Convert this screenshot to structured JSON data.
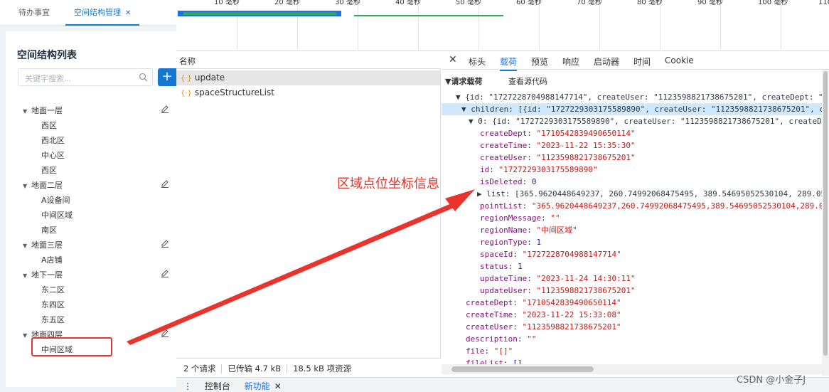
{
  "app": {
    "tabs": [
      {
        "label": "待办事宜"
      },
      {
        "label": "空间结构管理"
      }
    ],
    "panel_title": "空间结构列表",
    "search_placeholder": "关键字搜索...",
    "add_label": "+",
    "floors": [
      {
        "label": "地面一层",
        "rooms": [
          "西区",
          "西北区",
          "中心区",
          "西区"
        ]
      },
      {
        "label": "地面二层",
        "rooms": [
          "A设备间",
          "中间区域",
          "南区"
        ]
      },
      {
        "label": "地面三层",
        "rooms": [
          "A店铺"
        ]
      },
      {
        "label": "地下一层",
        "rooms": [
          "东二区",
          "东四区",
          "东五区"
        ]
      },
      {
        "label": "地面四层",
        "rooms": [
          "中间区域"
        ]
      }
    ]
  },
  "timeline": {
    "ticks": [
      "10 毫秒",
      "20 毫秒",
      "30 毫秒",
      "40 毫秒",
      "50 毫秒",
      "60 毫秒",
      "70 毫秒",
      "80 毫秒",
      "90 毫秒",
      "100 毫秒",
      "110 毫"
    ]
  },
  "network": {
    "column_header": "名称",
    "requests": [
      {
        "name": "update"
      },
      {
        "name": "spaceStructureList"
      }
    ],
    "status": {
      "requests": "2 个请求",
      "transferred": "已传输 4.7 kB",
      "resources": "18.5 kB 项资源"
    }
  },
  "detail": {
    "tabs": [
      "标头",
      "载荷",
      "预览",
      "响应",
      "启动器",
      "时间",
      "Cookie"
    ],
    "section_title": "▼请求载荷",
    "view_source": "查看源代码",
    "lines": [
      {
        "text": "▼ {id: \"1727228704988147714\", createUser: \"1123598821738675201\", createDept: \""
      },
      {
        "text": "▼ children: [{id: \"1727229303175589890\", createUser: \"1123598821738675201\", c"
      },
      {
        "text": "▼ 0: {id: \"1727229303175589890\", createUser: \"1123598821738675201\", createD"
      },
      {
        "key": "createDept",
        "val": "\"1710542839490650114\""
      },
      {
        "key": "createTime",
        "val": "\"2023-11-22 15:35:30\""
      },
      {
        "key": "createUser",
        "val": "\"1123598821738675201\""
      },
      {
        "key": "id",
        "val": "\"1727229303175589890\""
      },
      {
        "key": "isDeleted",
        "val": "0"
      },
      {
        "text": "▶ list: [365.9620448649237, 260.74992068475495, 389.54695052530104, 289.05"
      },
      {
        "key": "pointList",
        "val": "\"365.9620448649237,260.74992068475495,389.54695052530104,289.0"
      },
      {
        "key": "regionMessage",
        "val": "\"\""
      },
      {
        "key": "regionName",
        "val": "\"中间区域\""
      },
      {
        "key": "regionType",
        "val": "1"
      },
      {
        "key": "spaceId",
        "val": "\"1727228704988147714\""
      },
      {
        "key": "status",
        "val": "1"
      },
      {
        "key": "updateTime",
        "val": "\"2023-11-24 14:30:11\""
      },
      {
        "key": "updateUser",
        "val": "\"1123598821738675201\""
      },
      {
        "key": "createDept",
        "val": "\"1710542839490650114\""
      },
      {
        "key": "createTime",
        "val": "\"2023-11-22 15:33:08\""
      },
      {
        "key": "createUser",
        "val": "\"1123598821738675201\""
      },
      {
        "key": "description",
        "val": "\"\""
      },
      {
        "key": "file",
        "val": "\"[]\""
      },
      {
        "key": "fileList",
        "val": "[]"
      }
    ]
  },
  "drawer": {
    "console": "控制台",
    "new_features": "新功能"
  },
  "annotation": "区域点位坐标信息",
  "watermark": "CSDN @小金子J"
}
